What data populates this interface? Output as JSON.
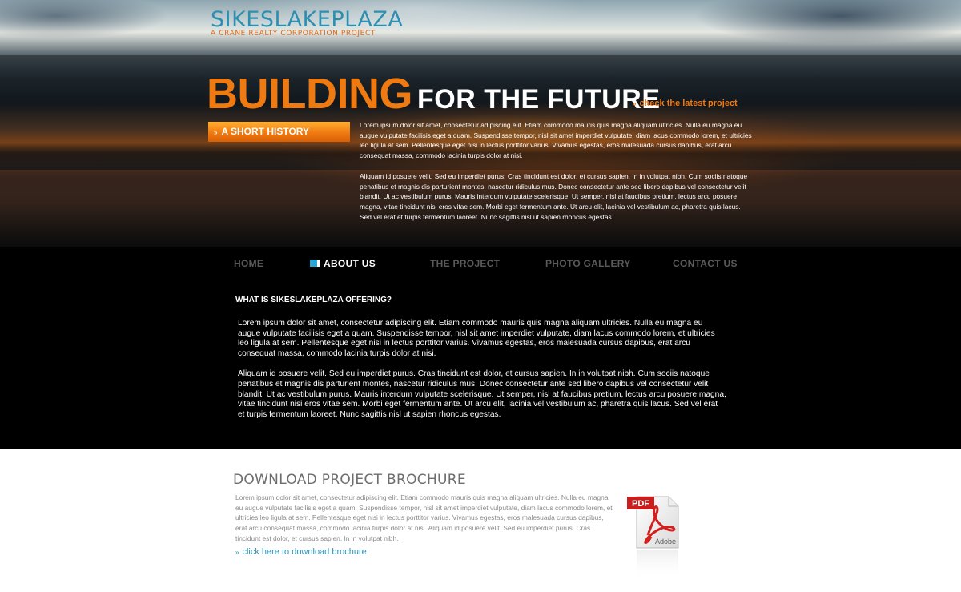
{
  "brand": {
    "name": "SIKESLAKEPLAZA",
    "tagline": "A CRANE REALTY CORPORATION PROJECT"
  },
  "hero": {
    "headline_orange": "BUILDING",
    "headline_white": "FOR THE FUTURE",
    "check_link": "check the latest project",
    "history_button": "A SHORT HISTORY",
    "paragraphs": [
      "Lorem ipsum dolor sit amet, consectetur adipiscing elit. Etiam commodo mauris quis magna aliquam ultricies. Nulla eu magna eu augue vulputate facilisis eget a quam. Suspendisse tempor, nisl sit amet imperdiet vulputate, diam lacus commodo lorem, et ultricies leo ligula at sem. Pellentesque eget nisi in lectus porttitor varius. Vivamus egestas, eros malesuada cursus dapibus, erat arcu consequat massa, commodo lacinia turpis dolor at nisi.",
      "Aliquam id posuere velit. Sed eu imperdiet purus. Cras tincidunt est dolor, et cursus sapien. In in volutpat nibh. Cum sociis natoque penatibus et magnis dis parturient montes, nascetur ridiculus mus. Donec consectetur ante sed libero dapibus vel consectetur velit blandit. Ut ac vestibulum purus. Mauris interdum vulputate scelerisque. Ut semper, nisl at faucibus pretium, lectus arcu posuere magna, vitae tincidunt nisi eros vitae sem. Morbi eget fermentum ante. Ut arcu elit, lacinia vel vestibulum ac, pharetra quis lacus. Sed vel erat et turpis fermentum laoreet. Nunc sagittis nisl ut sapien rhoncus egestas."
    ]
  },
  "nav": {
    "items": [
      "HOME",
      "ABOUT US",
      "THE PROJECT",
      "PHOTO GALLERY",
      "CONTACT US"
    ],
    "active": "ABOUT US"
  },
  "about": {
    "title": "WHAT IS SIKESLAKEPLAZA OFFERING?",
    "paragraphs": [
      "Lorem ipsum dolor sit amet, consectetur adipiscing elit. Etiam commodo mauris quis magna aliquam ultricies. Nulla eu magna eu augue vulputate facilisis eget a quam. Suspendisse tempor, nisl sit amet imperdiet vulputate, diam lacus commodo lorem, et ultricies leo ligula at sem. Pellentesque eget nisi in lectus porttitor varius. Vivamus egestas, eros malesuada cursus dapibus, erat arcu consequat massa, commodo lacinia turpis dolor at nisi.",
      "Aliquam id posuere velit. Sed eu imperdiet purus. Cras tincidunt est dolor, et cursus sapien. In in volutpat nibh. Cum sociis natoque penatibus et magnis dis parturient montes, nascetur ridiculus mus. Donec consectetur ante sed libero dapibus vel consectetur velit blandit. Ut ac vestibulum purus. Mauris interdum vulputate scelerisque. Ut semper, nisl at faucibus pretium, lectus arcu posuere magna, vitae tincidunt nisi eros vitae sem. Morbi eget fermentum ante. Ut arcu elit, lacinia vel vestibulum ac, pharetra quis lacus. Sed vel erat et turpis fermentum laoreet. Nunc sagittis nisl ut sapien rhoncus egestas."
    ]
  },
  "download": {
    "title": "DOWNLOAD PROJECT BROCHURE",
    "text": "Lorem ipsum dolor sit amet, consectetur adipiscing elit. Etiam commodo mauris quis magna aliquam ultricies. Nulla eu magna eu augue vulputate facilisis eget a quam. Suspendisse tempor, nisl sit amet imperdiet vulputate, diam lacus commodo lorem, et ultricies leo ligula at sem. Pellentesque eget nisi in lectus porttitor varius. Vivamus egestas, eros malesuada cursus dapibus, erat arcu consequat massa, commodo lacinia turpis dolor at nisi. Aliquam id posuere velit. Sed eu imperdiet purus. Cras tincidunt est dolor, et cursus sapien. In in volutpat nibh.",
    "link": "click here to download brochure",
    "pdf_icon": {
      "badge": "PDF",
      "brand": "Adobe"
    }
  },
  "colors": {
    "accent_orange": "#f07a12",
    "accent_blue": "#2d8fb0",
    "nav_active_marker": "#2ba4d6"
  },
  "icons": {
    "arrow": "double-chevron-right-icon",
    "pdf": "adobe-pdf-icon"
  }
}
